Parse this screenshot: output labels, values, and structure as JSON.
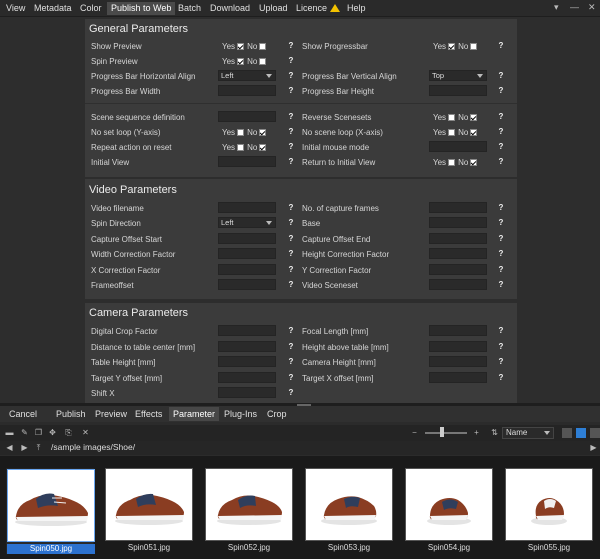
{
  "menu": [
    {
      "label": "View"
    },
    {
      "label": "Metadata"
    },
    {
      "label": "Color"
    },
    {
      "label": "Publish to Web"
    },
    {
      "label": "Batch"
    },
    {
      "label": "Download"
    },
    {
      "label": "Upload"
    },
    {
      "label": "Licence"
    },
    {
      "label": "Help"
    }
  ],
  "window_controls": [
    "▾",
    "—",
    "✕"
  ],
  "general": {
    "title": "General Parameters",
    "show_preview": "Show Preview",
    "spin_preview": "Spin Preview",
    "pb_h_align": "Progress Bar Horizontal Align",
    "pb_h_align_value": "Left",
    "pb_width": "Progress Bar Width",
    "show_progressbar": "Show Progressbar",
    "pb_v_align": "Progress Bar Vertical Align",
    "pb_v_align_value": "Top",
    "pb_height": "Progress Bar Height",
    "scene_seq": "Scene sequence definition",
    "no_set_loop": "No set loop (Y-axis)",
    "repeat_reset": "Repeat action on reset",
    "initial_view": "Initial View",
    "reverse_scenesets": "Reverse Scenesets",
    "no_scene_loop": "No scene loop (X-axis)",
    "initial_mouse": "Initial mouse mode",
    "return_initial": "Return to Initial View",
    "yes": "Yes",
    "no": "No",
    "help": "?"
  },
  "video": {
    "title": "Video Parameters",
    "filename": "Video filename",
    "spin_dir": "Spin Direction",
    "spin_dir_value": "Left",
    "cap_start": "Capture Offset Start",
    "width_corr": "Width Correction Factor",
    "x_corr": "X Correction Factor",
    "frameoffset": "Frameoffset",
    "no_capture": "No. of capture frames",
    "base": "Base",
    "cap_end": "Capture Offset End",
    "height_corr": "Height Correction Factor",
    "y_corr": "Y Correction Factor",
    "sceneset": "Video Sceneset"
  },
  "camera": {
    "title": "Camera Parameters",
    "crop": "Digital Crop Factor",
    "dist": "Distance to table center [mm]",
    "table_h": "Table Height [mm]",
    "target_y": "Target Y offset [mm]",
    "shift_x": "Shift X",
    "focal": "Focal Length [mm]",
    "height_above": "Height above table [mm]",
    "cam_h": "Camera Height [mm]",
    "target_x": "Target X offset [mm]"
  },
  "tabs": [
    {
      "label": "Cancel"
    },
    {
      "label": "Publish"
    },
    {
      "label": "Preview"
    },
    {
      "label": "Effects"
    },
    {
      "label": "Parameter"
    },
    {
      "label": "Plug-Ins"
    },
    {
      "label": "Crop"
    }
  ],
  "toolbar": {
    "sort_value": "Name",
    "zoom_minus": "−",
    "zoom_plus": "+"
  },
  "path": "/sample images/Shoe/",
  "thumbnails": [
    {
      "label": "Spin050.jpg",
      "selected": true
    },
    {
      "label": "Spin051.jpg"
    },
    {
      "label": "Spin052.jpg"
    },
    {
      "label": "Spin053.jpg"
    },
    {
      "label": "Spin054.jpg"
    },
    {
      "label": "Spin055.jpg"
    }
  ],
  "colors": {
    "accent": "#2c72d0",
    "panel": "#3b3b3b",
    "shoe_brown": "#8a3d22",
    "shoe_navy": "#2f3e5c"
  }
}
